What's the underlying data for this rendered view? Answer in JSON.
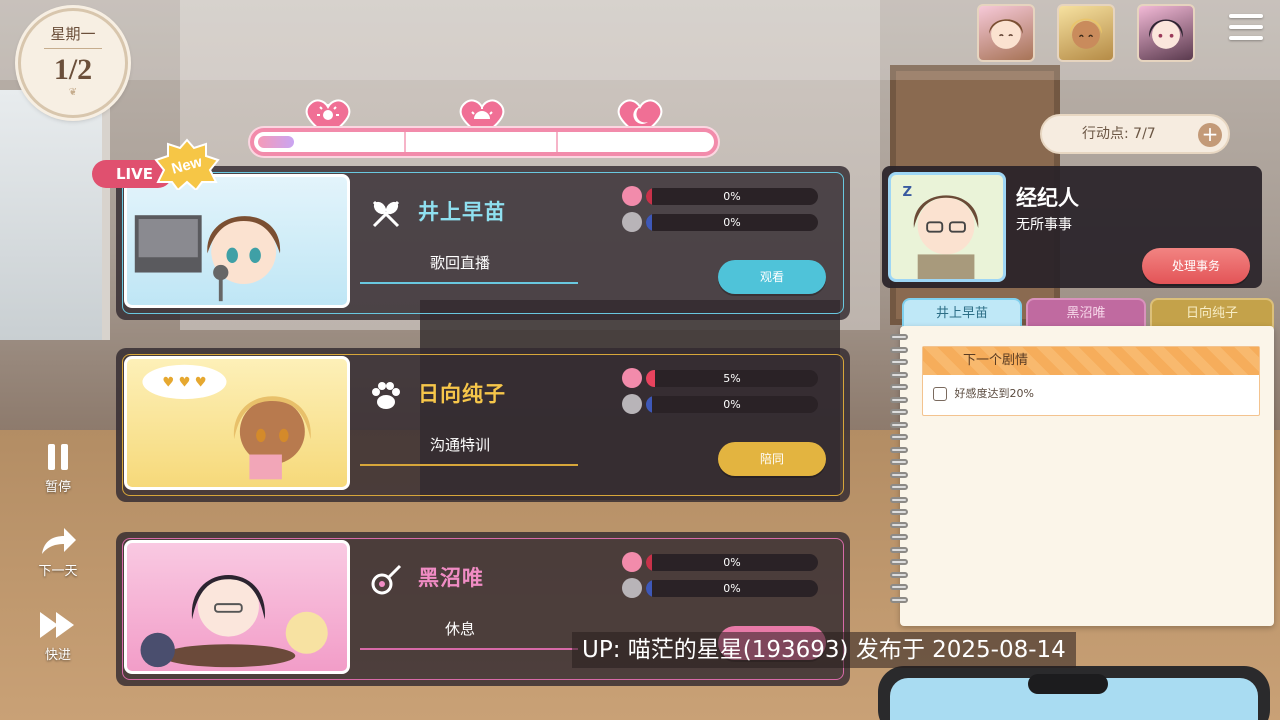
{
  "day": {
    "weekday": "星期一",
    "count": "1/2"
  },
  "time_progress": 0.08,
  "time_markers": [
    "sun-morning-icon",
    "sun-noon-icon",
    "moon-icon"
  ],
  "action_points": {
    "label": "行动点: 7/7",
    "plus": "+"
  },
  "top_portraits": [
    "井上早苗",
    "日向纯子",
    "黑沼唯"
  ],
  "badges": {
    "live": "LIVE",
    "new": "New"
  },
  "cards": [
    {
      "name": "井上早苗",
      "name_color": "#8fe0f0",
      "activity": "歌回直播",
      "affection": "0%",
      "affection_value": 0,
      "trust": "0%",
      "trust_value": 0,
      "button": "观看",
      "button_color": "#4fc3d9",
      "accent": "#69c8e0",
      "icon": "microphone-crossed-icon"
    },
    {
      "name": "日向纯子",
      "name_color": "#f6c64a",
      "activity": "沟通特训",
      "affection": "5%",
      "affection_value": 5,
      "trust": "0%",
      "trust_value": 0,
      "button": "陪同",
      "button_color": "#e3b440",
      "accent": "#d7a63a",
      "icon": "paw-icon"
    },
    {
      "name": "黑沼唯",
      "name_color": "#f08cc4",
      "activity": "休息",
      "affection": "0%",
      "affection_value": 0,
      "trust": "0%",
      "trust_value": 0,
      "button": "",
      "button_color": "#e87aa8",
      "accent": "#d76aa8",
      "icon": "guitar-icon"
    }
  ],
  "controls": [
    {
      "label": "暂停",
      "icon": "pause-icon"
    },
    {
      "label": "下一天",
      "icon": "share-arrow-icon"
    },
    {
      "label": "快进",
      "icon": "fast-forward-icon"
    }
  ],
  "manager": {
    "title": "经纪人",
    "status": "无所事事",
    "button": "处理事务"
  },
  "tabs": [
    "井上早苗",
    "黑沼唯",
    "日向纯子"
  ],
  "notebook": {
    "header": "下一个剧情",
    "items": [
      "好感度达到20%"
    ]
  },
  "watermark": "UP: 喵茫的星星(193693) 发布于 2025-08-14"
}
